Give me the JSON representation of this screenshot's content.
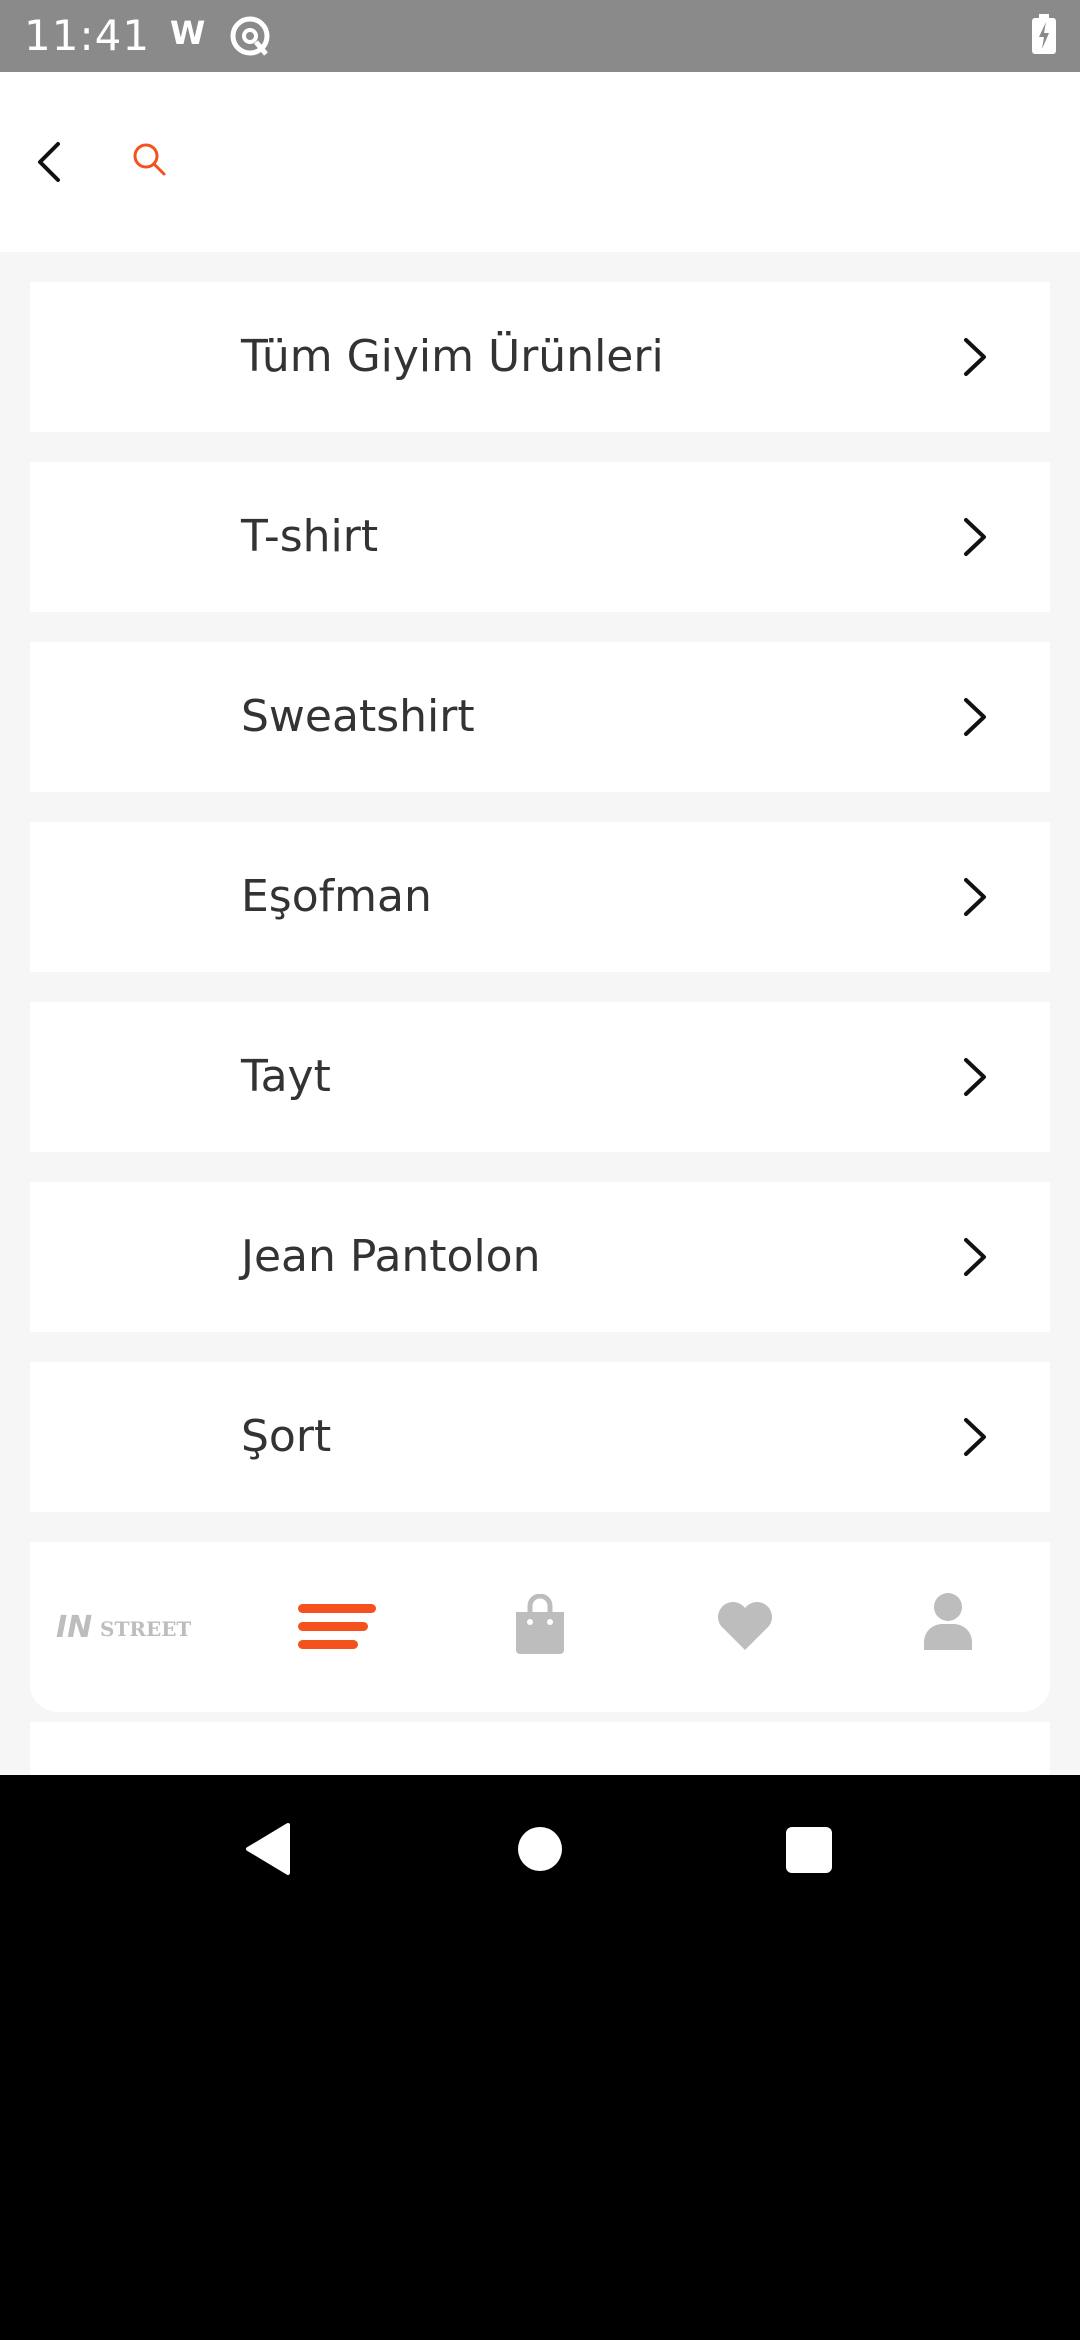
{
  "status_bar": {
    "time": "11:41",
    "indicator": "W",
    "icons": [
      "w-icon",
      "at-circle-icon",
      "battery-charging-icon"
    ]
  },
  "header": {
    "back_icon": "chevron-left-icon",
    "search_icon": "search-icon"
  },
  "menu": {
    "items": [
      {
        "label": "Tüm Giyim Ürünleri"
      },
      {
        "label": "T-shirt"
      },
      {
        "label": "Sweatshirt"
      },
      {
        "label": "Eşofman"
      },
      {
        "label": "Tayt"
      },
      {
        "label": "Jean Pantolon"
      },
      {
        "label": "Şort"
      }
    ]
  },
  "bottom_nav": {
    "logo": "INSTREET",
    "items": [
      "logo",
      "menu-icon",
      "bag-icon",
      "heart-icon",
      "user-icon"
    ],
    "active": "menu-icon"
  },
  "colors": {
    "accent": "#f4511e",
    "inactive_icon": "#bdbdbd",
    "text": "#333333",
    "background": "#f6f6f6"
  }
}
